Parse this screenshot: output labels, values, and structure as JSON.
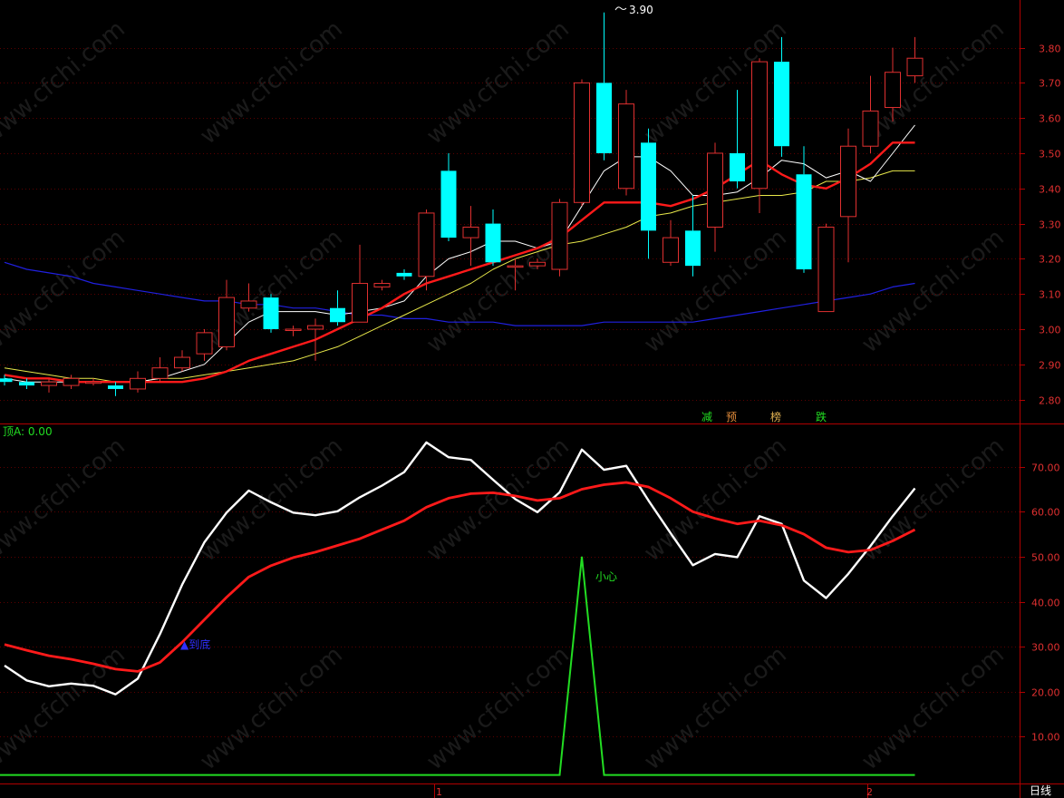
{
  "colors": {
    "background": "#000000",
    "axis_red": "#b00000",
    "grid_red": "#5a0000",
    "tick_text": "#e03030",
    "up_candle": "#e03030",
    "down_candle": "#00ffff",
    "ma_fast": "#ffffff",
    "ma_mid": "#ff1a1a",
    "ma_slow": "#e8e84a",
    "ma_long": "#2020e0",
    "osc_fast": "#ffffff",
    "osc_slow": "#ff1a1a",
    "signal": "#22dd22"
  },
  "watermark": "www.cfchi.com",
  "chart_data": [
    {
      "type": "candlestick",
      "price_range": [
        2.75,
        3.92
      ],
      "y_ticks": [
        "3.80",
        "3.70",
        "3.60",
        "3.50",
        "3.40",
        "3.30",
        "3.20",
        "3.10",
        "3.00",
        "2.90",
        "2.80"
      ],
      "y_tick_values": [
        3.8,
        3.7,
        3.6,
        3.5,
        3.4,
        3.3,
        3.2,
        3.1,
        3.0,
        2.9,
        2.8
      ],
      "high_label": "3.90",
      "markers": [
        {
          "text": "减",
          "color": "#22dd22"
        },
        {
          "text": "预",
          "color": "#e08a3a"
        },
        {
          "text": "榜",
          "color": "#e0b050"
        },
        {
          "text": "跌",
          "color": "#22dd22"
        }
      ],
      "candles": [
        [
          2.86,
          2.85,
          2.87,
          2.84
        ],
        [
          2.85,
          2.84,
          2.86,
          2.83
        ],
        [
          2.84,
          2.85,
          2.86,
          2.82
        ],
        [
          2.84,
          2.86,
          2.87,
          2.83
        ],
        [
          2.85,
          2.85,
          2.86,
          2.84
        ],
        [
          2.84,
          2.83,
          2.85,
          2.81
        ],
        [
          2.83,
          2.86,
          2.88,
          2.82
        ],
        [
          2.86,
          2.89,
          2.92,
          2.85
        ],
        [
          2.89,
          2.92,
          2.94,
          2.88
        ],
        [
          2.93,
          2.99,
          3.0,
          2.91
        ],
        [
          2.95,
          3.09,
          3.14,
          2.94
        ],
        [
          3.06,
          3.08,
          3.13,
          3.05
        ],
        [
          3.09,
          3.0,
          3.1,
          2.99
        ],
        [
          3.0,
          3.0,
          3.01,
          2.98
        ],
        [
          3.0,
          3.01,
          3.03,
          2.91
        ],
        [
          3.06,
          3.02,
          3.11,
          3.01
        ],
        [
          3.02,
          3.13,
          3.24,
          3.02
        ],
        [
          3.12,
          3.13,
          3.14,
          3.11
        ],
        [
          3.16,
          3.15,
          3.17,
          3.14
        ],
        [
          3.15,
          3.33,
          3.34,
          3.11
        ],
        [
          3.45,
          3.26,
          3.5,
          3.25
        ],
        [
          3.26,
          3.29,
          3.35,
          3.18
        ],
        [
          3.3,
          3.19,
          3.34,
          3.18
        ],
        [
          3.18,
          3.18,
          3.2,
          3.11
        ],
        [
          3.18,
          3.19,
          3.2,
          3.17
        ],
        [
          3.17,
          3.36,
          3.37,
          3.15
        ],
        [
          3.36,
          3.7,
          3.71,
          3.35
        ],
        [
          3.7,
          3.5,
          3.9,
          3.48
        ],
        [
          3.4,
          3.64,
          3.68,
          3.38
        ],
        [
          3.53,
          3.28,
          3.57,
          3.2
        ],
        [
          3.19,
          3.26,
          3.31,
          3.18
        ],
        [
          3.28,
          3.18,
          3.38,
          3.15
        ],
        [
          3.29,
          3.5,
          3.53,
          3.22
        ],
        [
          3.5,
          3.42,
          3.68,
          3.4
        ],
        [
          3.4,
          3.76,
          3.77,
          3.33
        ],
        [
          3.76,
          3.52,
          3.83,
          3.49
        ],
        [
          3.44,
          3.17,
          3.52,
          3.16
        ],
        [
          3.05,
          3.29,
          3.3,
          3.05
        ],
        [
          3.32,
          3.52,
          3.57,
          3.19
        ],
        [
          3.52,
          3.62,
          3.72,
          3.5
        ],
        [
          3.63,
          3.73,
          3.8,
          3.59
        ],
        [
          3.72,
          3.77,
          3.83,
          3.7
        ]
      ],
      "ma_fast": [
        2.86,
        2.85,
        2.85,
        2.85,
        2.85,
        2.85,
        2.85,
        2.86,
        2.88,
        2.9,
        2.96,
        3.02,
        3.05,
        3.05,
        3.05,
        3.04,
        3.05,
        3.06,
        3.08,
        3.15,
        3.2,
        3.22,
        3.25,
        3.25,
        3.23,
        3.25,
        3.35,
        3.45,
        3.49,
        3.49,
        3.45,
        3.38,
        3.38,
        3.39,
        3.43,
        3.48,
        3.47,
        3.43,
        3.45,
        3.42,
        3.5,
        3.58
      ],
      "ma_mid": [
        2.87,
        2.86,
        2.86,
        2.85,
        2.85,
        2.85,
        2.85,
        2.85,
        2.85,
        2.86,
        2.88,
        2.91,
        2.93,
        2.95,
        2.97,
        3.0,
        3.03,
        3.06,
        3.1,
        3.13,
        3.15,
        3.17,
        3.19,
        3.21,
        3.23,
        3.26,
        3.31,
        3.36,
        3.36,
        3.36,
        3.35,
        3.37,
        3.4,
        3.44,
        3.48,
        3.44,
        3.41,
        3.4,
        3.43,
        3.47,
        3.53,
        3.53
      ],
      "ma_slow": [
        2.89,
        2.88,
        2.87,
        2.86,
        2.86,
        2.85,
        2.85,
        2.86,
        2.86,
        2.87,
        2.88,
        2.89,
        2.9,
        2.91,
        2.93,
        2.95,
        2.98,
        3.01,
        3.04,
        3.07,
        3.1,
        3.13,
        3.17,
        3.2,
        3.22,
        3.24,
        3.25,
        3.27,
        3.29,
        3.32,
        3.33,
        3.35,
        3.36,
        3.37,
        3.38,
        3.38,
        3.39,
        3.42,
        3.42,
        3.43,
        3.45,
        3.45
      ],
      "ma_long": [
        3.19,
        3.17,
        3.16,
        3.15,
        3.13,
        3.12,
        3.11,
        3.1,
        3.09,
        3.08,
        3.08,
        3.07,
        3.07,
        3.06,
        3.06,
        3.05,
        3.04,
        3.04,
        3.03,
        3.03,
        3.02,
        3.02,
        3.02,
        3.01,
        3.01,
        3.01,
        3.01,
        3.02,
        3.02,
        3.02,
        3.02,
        3.02,
        3.03,
        3.04,
        3.05,
        3.06,
        3.07,
        3.08,
        3.09,
        3.1,
        3.12,
        3.13
      ]
    },
    {
      "type": "line",
      "title": "顶A: 0.00",
      "y_range": [
        0,
        79
      ],
      "y_ticks": [
        "70.00",
        "60.00",
        "50.00",
        "40.00",
        "30.00",
        "20.00",
        "10.00"
      ],
      "y_tick_values": [
        70,
        60,
        50,
        40,
        30,
        20,
        10
      ],
      "series": [
        {
          "values": [
            25.8,
            22.5,
            21.2,
            21.8,
            21.3,
            19.4,
            22.9,
            32.8,
            43.8,
            53.2,
            59.8,
            64.7,
            62.1,
            59.8,
            59.2,
            60.1,
            63.2,
            65.8,
            68.8,
            75.4,
            72.1,
            71.5,
            67.1,
            62.8,
            59.9,
            64.3,
            73.8,
            69.3,
            70.2,
            62.5,
            55.2,
            48.1,
            50.6,
            49.9,
            59.0,
            57.3,
            44.7,
            40.8,
            46.2,
            52.4,
            59.0,
            65.2
          ]
        },
        {
          "values": [
            30.5,
            29.2,
            28.0,
            27.2,
            26.2,
            25.0,
            24.5,
            26.5,
            31.0,
            36.0,
            41.0,
            45.5,
            48.0,
            49.8,
            51.0,
            52.5,
            54.0,
            56.0,
            58.0,
            61.0,
            63.0,
            64.0,
            64.2,
            63.5,
            62.5,
            63.0,
            65.0,
            66.0,
            66.5,
            65.5,
            63.0,
            60.0,
            58.5,
            57.3,
            58.0,
            57.0,
            55.0,
            52.0,
            51.0,
            51.5,
            53.5,
            56.0
          ]
        },
        {
          "values": [
            1.5,
            1.5,
            1.5,
            1.5,
            1.5,
            1.5,
            1.5,
            1.5,
            1.5,
            1.5,
            1.5,
            1.5,
            1.5,
            1.5,
            1.5,
            1.5,
            1.5,
            1.5,
            1.5,
            1.5,
            1.5,
            1.5,
            1.5,
            1.5,
            1.5,
            1.5,
            50.0,
            1.5,
            1.5,
            1.5,
            1.5,
            1.5,
            1.5,
            1.5,
            1.5,
            1.5,
            1.5,
            1.5,
            1.5,
            1.5,
            1.5,
            1.5
          ]
        }
      ],
      "annotations": [
        {
          "text": "小心",
          "color": "#22dd22"
        },
        {
          "text": "▲到底",
          "color": "#3030ff"
        }
      ]
    }
  ],
  "x_axis": {
    "labels": [
      "1",
      "2"
    ],
    "period_label": "日线"
  }
}
